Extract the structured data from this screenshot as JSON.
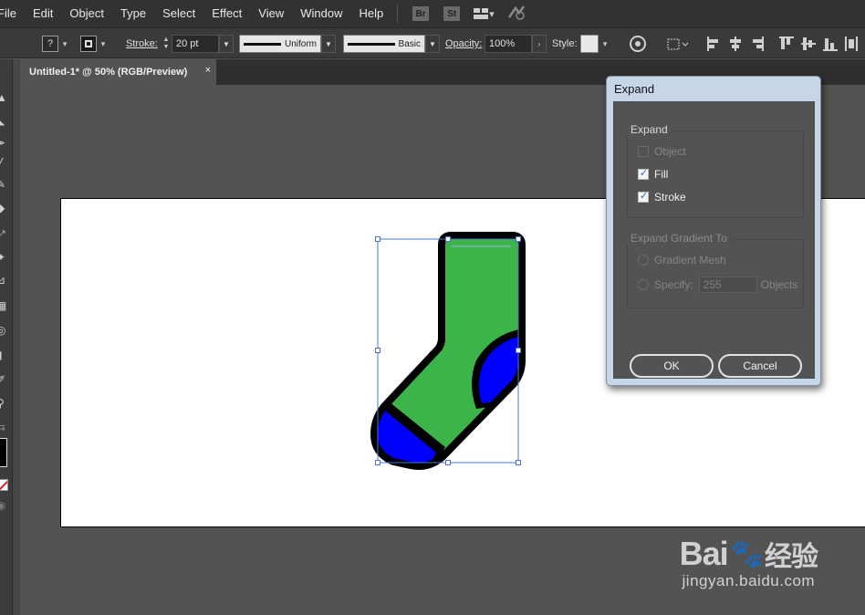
{
  "menu": {
    "items": [
      "File",
      "Edit",
      "Object",
      "Type",
      "Select",
      "Effect",
      "View",
      "Window",
      "Help"
    ],
    "app_badges": [
      "Br",
      "St"
    ],
    "workspace_caret": "▾"
  },
  "control": {
    "fill_glyph": "?",
    "stroke_label": "Stroke:",
    "stroke_value": "20 pt",
    "profile_uniform": "Uniform",
    "profile_basic": "Basic",
    "opacity_label": "Opacity:",
    "opacity_value": "100%",
    "style_label": "Style:"
  },
  "document": {
    "tab_title": "Untitled-1* @ 50% (RGB/Preview)",
    "tab_close": "×"
  },
  "colors": {
    "sock_green": "#3bb54a",
    "sock_blue": "#0000ff",
    "sock_stroke": "#000000",
    "selection": "#4a76d1",
    "checkbox_check": "#1b6ec9"
  },
  "dialog": {
    "title": "Expand",
    "expand_group": "Expand",
    "opt_object": "Object",
    "opt_fill": "Fill",
    "opt_stroke": "Stroke",
    "object_checked": false,
    "fill_checked": true,
    "stroke_checked": true,
    "gradient_group": "Expand Gradient To",
    "opt_gradient_mesh": "Gradient Mesh",
    "opt_specify": "Specify:",
    "specify_value": "255",
    "objects_label": "Objects",
    "ok": "OK",
    "cancel": "Cancel"
  },
  "watermark": {
    "brand_left": "Bai",
    "brand_paw": "🐾",
    "brand_right": "经验",
    "url": "jingyan.baidu.com"
  }
}
